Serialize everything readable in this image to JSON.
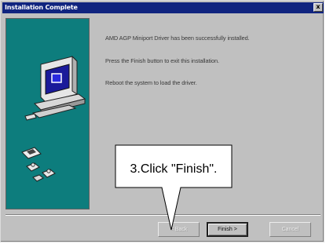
{
  "window": {
    "title": "Installation Complete",
    "close_glyph": "x"
  },
  "messages": [
    "AMD AGP Miniport Driver has been successfully installed.",
    "Press the Finish button to exit this installation.",
    "Reboot the system to load the driver."
  ],
  "buttons": {
    "back_label": "< Back",
    "finish_label": "Finish >",
    "cancel_label": "Cancel"
  },
  "callout": {
    "text": "3.Click \"Finish\"."
  },
  "colors": {
    "titlebar": "#10247f",
    "side_panel": "#0d7d7d",
    "dialog_face": "#c0c0c0"
  },
  "icons": [
    "computer-icon",
    "floppy-disk-icon",
    "puzzle-pieces-icon"
  ]
}
